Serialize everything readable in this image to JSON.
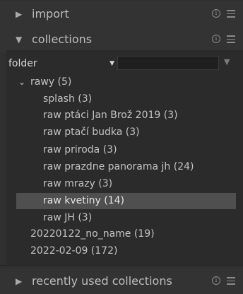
{
  "modules": {
    "import": {
      "title": "import",
      "arrow": "▶"
    },
    "collections": {
      "title": "collections",
      "arrow": "▼"
    },
    "recently_used": {
      "title": "recently used collections",
      "arrow": "▶"
    }
  },
  "filter": {
    "selected": "folder",
    "search_value": ""
  },
  "tree": {
    "root": {
      "label": "rawy (5)",
      "chevron": "˅"
    },
    "children": [
      {
        "label": "splash (3)"
      },
      {
        "label": "raw ptáci Jan Brož 2019 (3)"
      },
      {
        "label": "raw ptačí budka (3)"
      },
      {
        "label": "raw priroda (3)"
      },
      {
        "label": "raw prazdne panorama jh (24)"
      },
      {
        "label": "raw mrazy (3)"
      },
      {
        "label": "raw kvetiny (14)"
      },
      {
        "label": "raw JH (3)"
      }
    ],
    "others": [
      {
        "label": "20220122_no_name (19)"
      },
      {
        "label": "2022-02-09 (172)"
      }
    ]
  },
  "colors": {
    "background": "#303030",
    "panel": "#2b2b2b",
    "selected_row": "#4f4f4f"
  }
}
